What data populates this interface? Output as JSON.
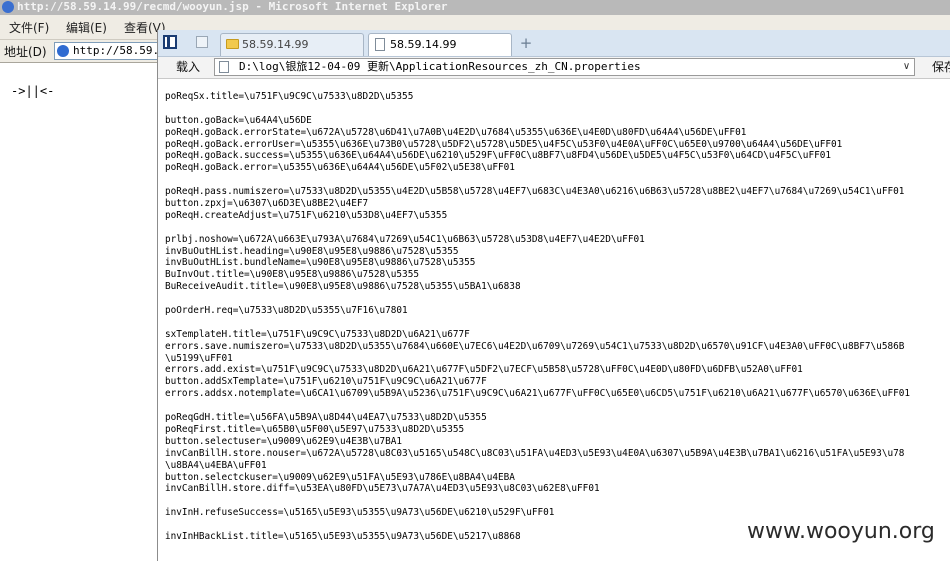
{
  "ie": {
    "title": "http://58.59.14.99/recmd/wooyun.jsp - Microsoft Internet Explorer",
    "menu": [
      "文件(F)",
      "编辑(E)",
      "查看(V)"
    ],
    "address_label": "地址(D)",
    "address_value": "http://58.59.1",
    "page_text": "->||<-"
  },
  "browser": {
    "tabs": [
      {
        "label": "58.59.14.99",
        "icon": "folder-icon",
        "active": false
      },
      {
        "label": "58.59.14.99",
        "icon": "document-icon",
        "active": true
      }
    ],
    "new_tab_label": "+",
    "load_label": "载入",
    "url": "D:\\log\\银旅12-04-09 更新\\ApplicationResources_zh_CN.properties",
    "dropdown_glyph": "∨",
    "save_label": "保存"
  },
  "file_lines": [
    "poReqSx.title=\\u751F\\u9C9C\\u7533\\u8D2D\\u5355",
    "",
    "button.goBack=\\u64A4\\u56DE",
    "poReqH.goBack.errorState=\\u672A\\u5728\\u6D41\\u7A0B\\u4E2D\\u7684\\u5355\\u636E\\u4E0D\\u80FD\\u64A4\\u56DE\\uFF01",
    "poReqH.goBack.errorUser=\\u5355\\u636E\\u73B0\\u5728\\u5DF2\\u5728\\u5DE5\\u4F5C\\u53F0\\u4E0A\\uFF0C\\u65E0\\u9700\\u64A4\\u56DE\\uFF01",
    "poReqH.goBack.success=\\u5355\\u636E\\u64A4\\u56DE\\u6210\\u529F\\uFF0C\\u8BF7\\u8FD4\\u56DE\\u5DE5\\u4F5C\\u53F0\\u64CD\\u4F5C\\uFF01",
    "poReqH.goBack.error=\\u5355\\u636E\\u64A4\\u56DE\\u5F02\\u5E38\\uFF01",
    "",
    "poReqH.pass.numiszero=\\u7533\\u8D2D\\u5355\\u4E2D\\u5B58\\u5728\\u4EF7\\u683C\\u4E3A0\\u6216\\u6B63\\u5728\\u8BE2\\u4EF7\\u7684\\u7269\\u54C1\\uFF01",
    "button.zpxj=\\u6307\\u6D3E\\u8BE2\\u4EF7",
    "poReqH.createAdjust=\\u751F\\u6210\\u53D8\\u4EF7\\u5355",
    "",
    "prlbj.noshow=\\u672A\\u663E\\u793A\\u7684\\u7269\\u54C1\\u6B63\\u5728\\u53D8\\u4EF7\\u4E2D\\uFF01",
    "invBuOutHList.heading=\\u90E8\\u95E8\\u9886\\u7528\\u5355",
    "invBuOutHList.bundleName=\\u90E8\\u95E8\\u9886\\u7528\\u5355",
    "BuInvOut.title=\\u90E8\\u95E8\\u9886\\u7528\\u5355",
    "BuReceiveAudit.title=\\u90E8\\u95E8\\u9886\\u7528\\u5355\\u5BA1\\u6838",
    "",
    "poOrderH.req=\\u7533\\u8D2D\\u5355\\u7F16\\u7801",
    "",
    "sxTemplateH.title=\\u751F\\u9C9C\\u7533\\u8D2D\\u6A21\\u677F",
    "errors.save.numiszero=\\u7533\\u8D2D\\u5355\\u7684\\u660E\\u7EC6\\u4E2D\\u6709\\u7269\\u54C1\\u7533\\u8D2D\\u6570\\u91CF\\u4E3A0\\uFF0C\\u8BF7\\u586B",
    "\\u5199\\uFF01",
    "errors.add.exist=\\u751F\\u9C9C\\u7533\\u8D2D\\u6A21\\u677F\\u5DF2\\u7ECF\\u5B58\\u5728\\uFF0C\\u4E0D\\u80FD\\u6DFB\\u52A0\\uFF01",
    "button.addSxTemplate=\\u751F\\u6210\\u751F\\u9C9C\\u6A21\\u677F",
    "errors.addsx.notemplate=\\u6CA1\\u6709\\u5B9A\\u5236\\u751F\\u9C9C\\u6A21\\u677F\\uFF0C\\u65E0\\u6CD5\\u751F\\u6210\\u6A21\\u677F\\u6570\\u636E\\uFF01",
    "",
    "poReqGdH.title=\\u56FA\\u5B9A\\u8D44\\u4EA7\\u7533\\u8D2D\\u5355",
    "poReqFirst.title=\\u65B0\\u5F00\\u5E97\\u7533\\u8D2D\\u5355",
    "button.selectuser=\\u9009\\u62E9\\u4E3B\\u7BA1",
    "invCanBillH.store.nouser=\\u672A\\u5728\\u8C03\\u5165\\u548C\\u8C03\\u51FA\\u4ED3\\u5E93\\u4E0A\\u6307\\u5B9A\\u4E3B\\u7BA1\\u6216\\u51FA\\u5E93\\u78",
    "\\u8BA4\\u4EBA\\uFF01",
    "button.selectckuser=\\u9009\\u62E9\\u51FA\\u5E93\\u786E\\u8BA4\\u4EBA",
    "invCanBillH.store.diff=\\u53EA\\u80FD\\u5E73\\u7A7A\\u4ED3\\u5E93\\u8C03\\u62E8\\uFF01",
    "",
    "invInH.refuseSuccess=\\u5165\\u5E93\\u5355\\u9A73\\u56DE\\u6210\\u529F\\uFF01",
    "",
    "invInHBackList.title=\\u5165\\u5E93\\u5355\\u9A73\\u56DE\\u5217\\u8868"
  ],
  "watermark": "www.wooyun.org"
}
